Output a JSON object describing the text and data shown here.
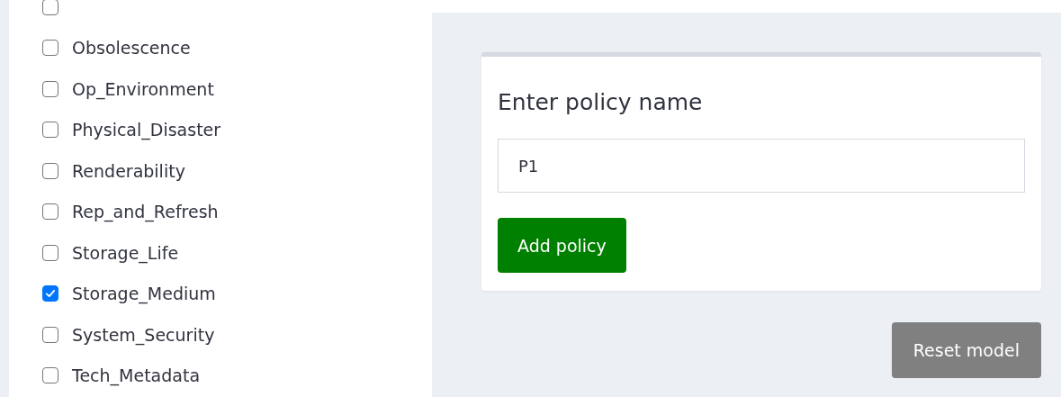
{
  "checklist": [
    {
      "checked": false
    },
    {
      "label": "Obsolescence",
      "checked": false
    },
    {
      "label": "Op_Environment",
      "checked": false
    },
    {
      "label": "Physical_Disaster",
      "checked": false
    },
    {
      "label": "Renderability",
      "checked": false
    },
    {
      "label": "Rep_and_Refresh",
      "checked": false
    },
    {
      "label": "Storage_Life",
      "checked": false
    },
    {
      "label": "Storage_Medium",
      "checked": true
    },
    {
      "label": "System_Security",
      "checked": false
    },
    {
      "label": "Tech_Metadata",
      "checked": false
    }
  ],
  "policy_card": {
    "heading": "Enter policy name",
    "input": {
      "value": "P1"
    },
    "button": "Add policy"
  },
  "reset_button": "Reset model"
}
